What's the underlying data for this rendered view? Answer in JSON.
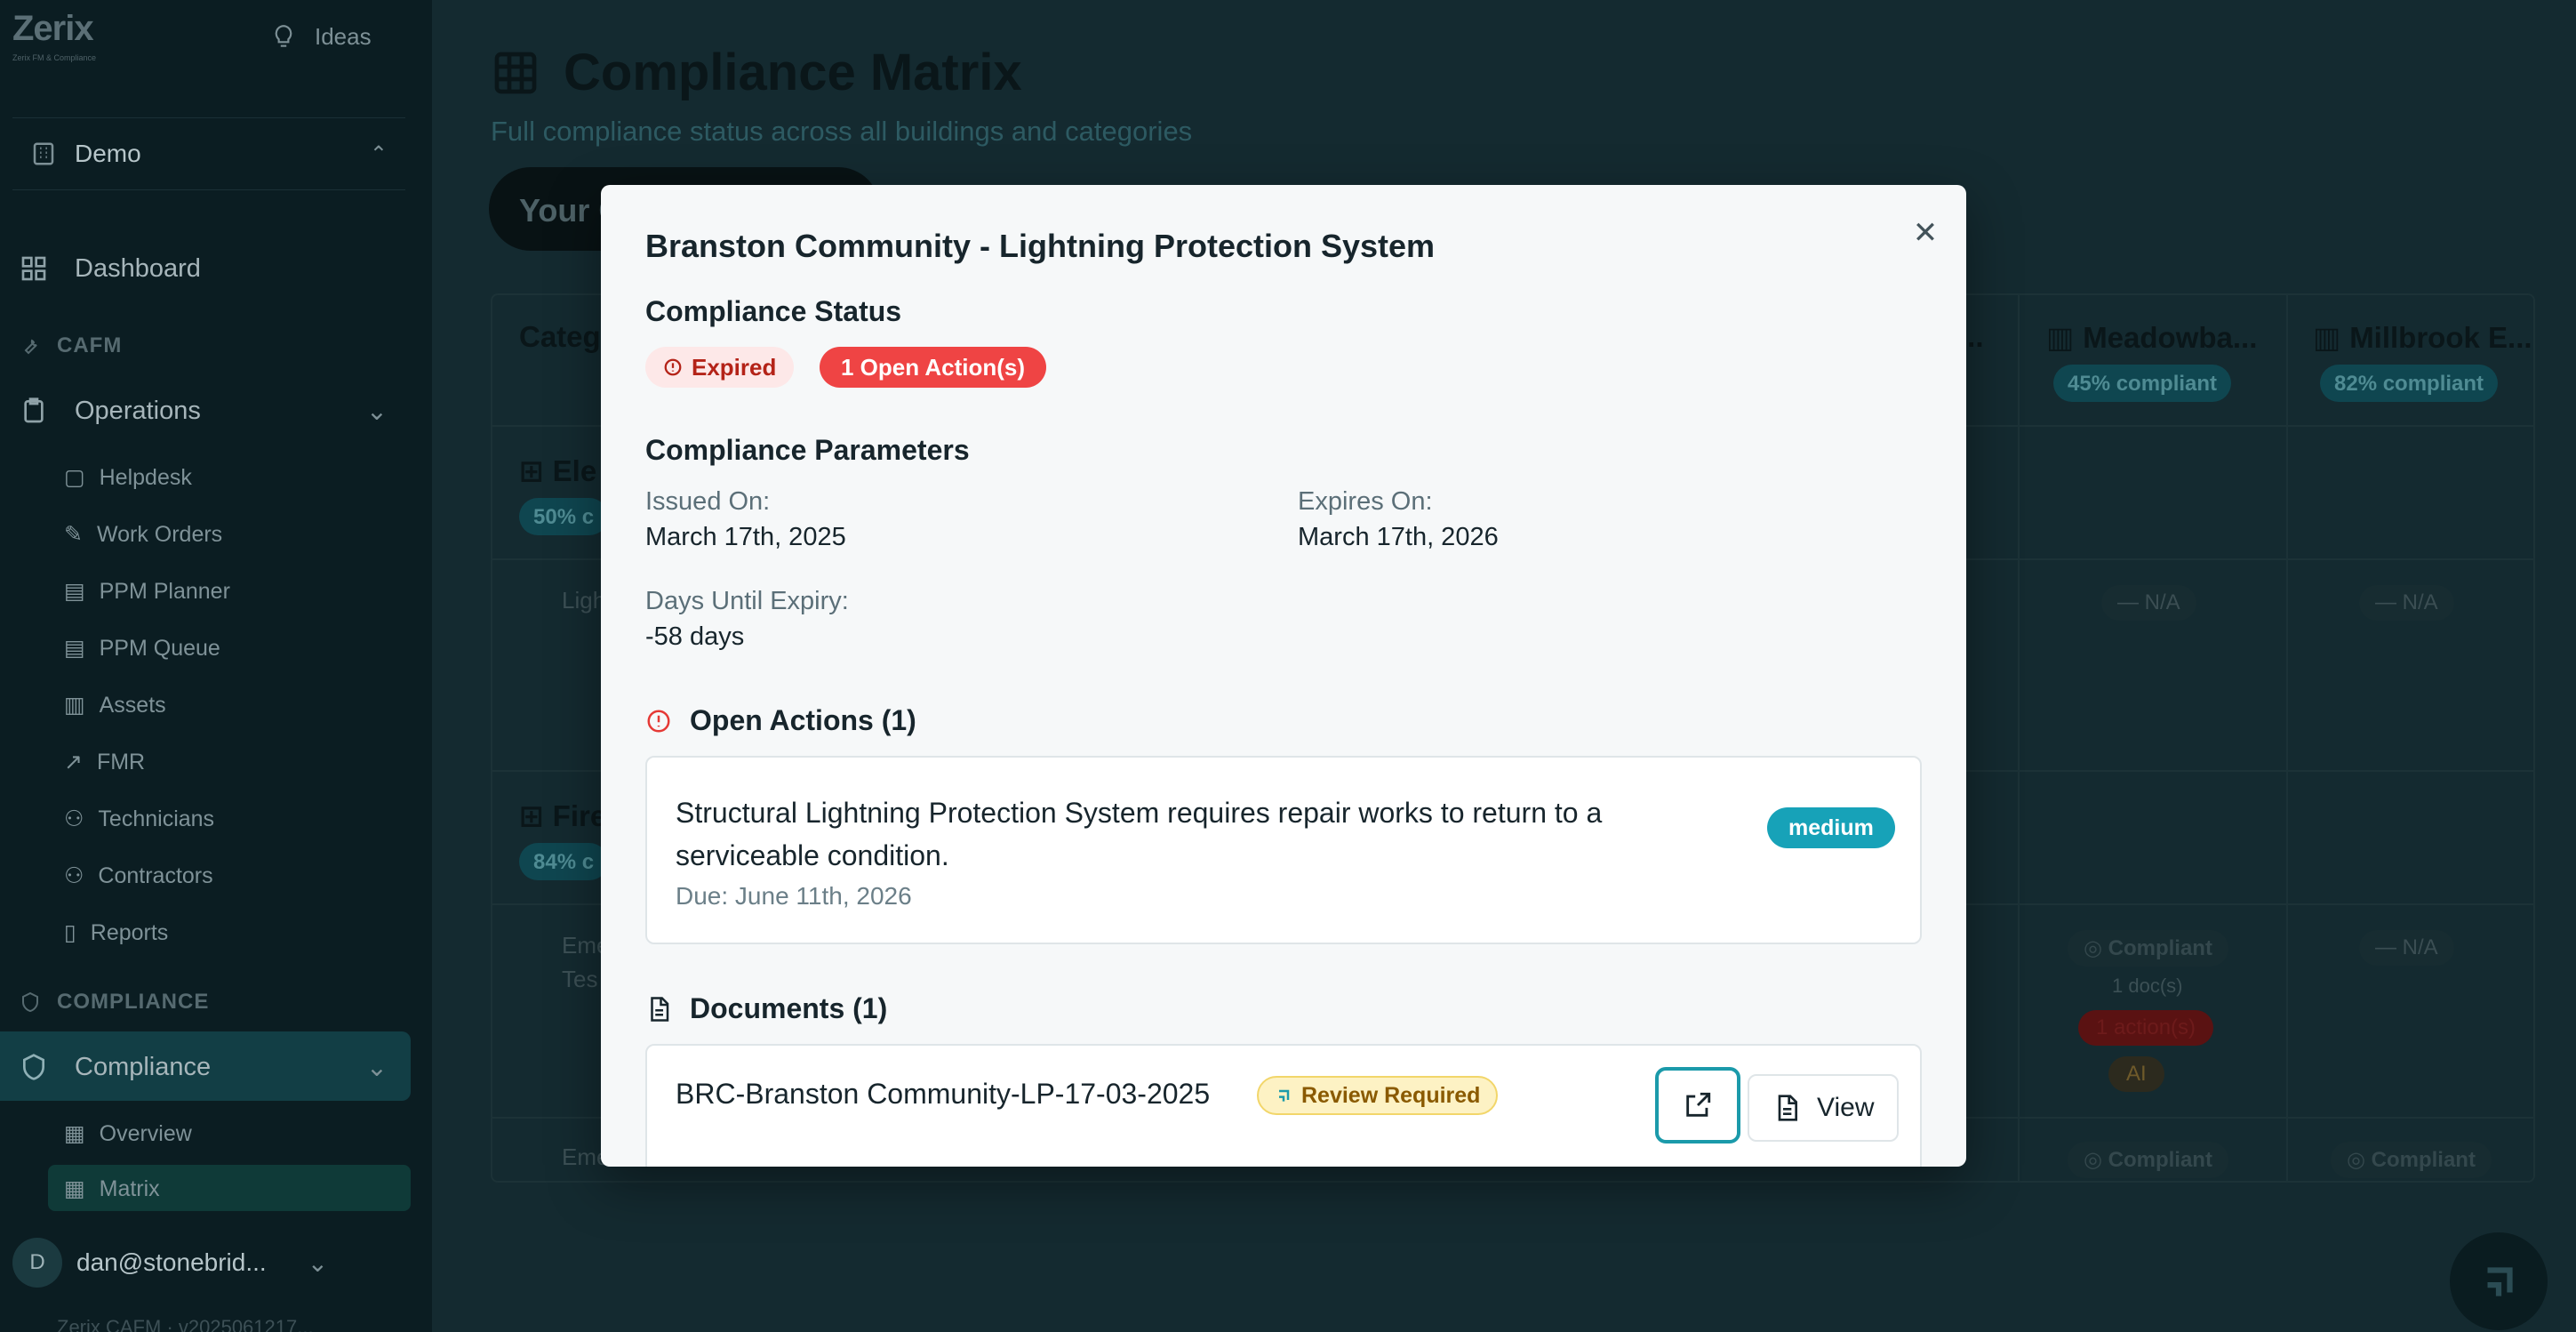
{
  "sidebar": {
    "logo_text": "Zerix",
    "logo_tagline": "Zerix FM & Compliance",
    "ideas_label": "Ideas",
    "workspace": "Demo",
    "dashboard": "Dashboard",
    "section_cafm": "CAFM",
    "operations": "Operations",
    "ops_items": [
      "Helpdesk",
      "Work Orders",
      "PPM Planner",
      "PPM Queue",
      "Assets",
      "FMR",
      "Technicians",
      "Contractors",
      "Reports"
    ],
    "section_compliance": "COMPLIANCE",
    "compliance": "Compliance",
    "compliance_items": [
      "Overview",
      "Matrix"
    ],
    "user_initial": "D",
    "user_email": "dan@stonebrid...",
    "version": "Zerix CAFM · v2025061217..."
  },
  "main": {
    "title": "Compliance Matrix",
    "subtitle": "Full compliance status across all buildings and categories",
    "pill_button": "Your C...",
    "col_category": "Categ",
    "col_building_partial": "...",
    "col_meadowbank": "Meadowba...",
    "col_millbrook": "Millbrook E...",
    "meadowbank_pct": "45% compliant",
    "millbrook_pct": "82% compliant",
    "cat_electrical": "Ele",
    "cat_electrical_pct": "50% c",
    "row_lightning": "Ligh",
    "cat_fire": "Fire",
    "cat_fire_pct": "84% c",
    "row_emergency1_a": "Eme",
    "row_emergency1_b": "Tes",
    "row_emergency2": "Eme",
    "na": "— N/A",
    "compliant": "Compliant",
    "docs": "1 doc(s)",
    "actions": "1 action(s)",
    "ai": "AI"
  },
  "modal": {
    "title": "Branston Community - Lightning Protection System",
    "status_heading": "Compliance Status",
    "badge_expired": "Expired",
    "badge_open_actions": "1 Open Action(s)",
    "params_heading": "Compliance Parameters",
    "issued_label": "Issued On:",
    "issued_value": "March 17th, 2025",
    "expires_label": "Expires On:",
    "expires_value": "March 17th, 2026",
    "days_label": "Days Until Expiry:",
    "days_value": "-58 days",
    "open_actions_heading": "Open Actions (1)",
    "action_text": "Structural Lightning Protection System requires repair works to return to a serviceable condition.",
    "action_due": "Due: June 11th, 2026",
    "action_priority": "medium",
    "documents_heading": "Documents (1)",
    "doc_name": "BRC-Branston Community-LP-17-03-2025",
    "doc_status": "Review Required",
    "view_label": "View"
  },
  "colors": {
    "accent": "#17a2b8",
    "danger": "#ef4444",
    "warning_bg": "#fdf2c4",
    "sidebar_bg": "#0b1d22"
  }
}
